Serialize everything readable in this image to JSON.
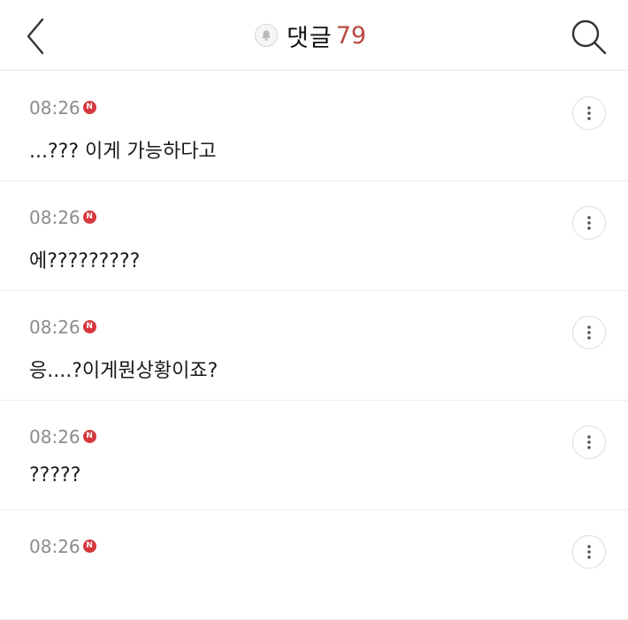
{
  "header": {
    "title": "댓글",
    "count": "79",
    "back_icon": "chevron-left-icon",
    "search_icon": "search-icon",
    "bell_icon": "bell-icon"
  },
  "colors": {
    "accent": "#b84a44",
    "badge": "#d6373d"
  },
  "comments": [
    {
      "time": "08:26",
      "badge": "N",
      "text": "...??? 이게 가능하다고"
    },
    {
      "time": "08:26",
      "badge": "N",
      "text": "에?????????"
    },
    {
      "time": "08:26",
      "badge": "N",
      "text": "응....?이게뭔상황이죠?"
    },
    {
      "time": "08:26",
      "badge": "N",
      "text": "?????"
    },
    {
      "time": "08:26",
      "badge": "N",
      "text": ""
    }
  ]
}
